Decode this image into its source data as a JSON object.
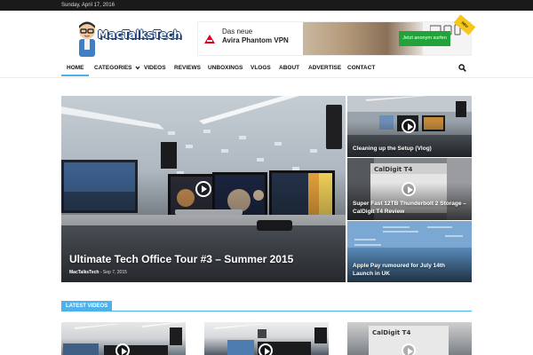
{
  "topbar": {
    "date": "Sunday, April 17, 2016"
  },
  "header": {
    "logo_text": "MacTalksTech",
    "ad": {
      "brand_line1": "Das neue",
      "brand_line2": "Avira Phantom VPN",
      "button_label": "Jetzt anonym surfen",
      "badge": "NEU"
    }
  },
  "nav": {
    "items": [
      {
        "label": "HOME"
      },
      {
        "label": "CATEGORIES"
      },
      {
        "label": "VIDEOS"
      },
      {
        "label": "REVIEWS"
      },
      {
        "label": "UNBOXINGS"
      },
      {
        "label": "VLOGS"
      },
      {
        "label": "ABOUT"
      },
      {
        "label": "ADVERTISE"
      },
      {
        "label": "CONTACT"
      }
    ],
    "dropdown_icon": "chevron-down-icon",
    "search_icon": "search-icon",
    "accent": "#4db2ec"
  },
  "featured": {
    "main": {
      "title": "Ultimate Tech Office Tour #3 – Summer 2015",
      "author": "MacTalksTech",
      "date": "Sep 7, 2015"
    },
    "side": [
      {
        "title": "Cleaning up the Setup (Vlog)"
      },
      {
        "title": "Super Fast 12TB Thunderbolt 2 Storage – CalDigit T4 Review"
      },
      {
        "title": "Apple Pay rumoured for July 14th Launch in UK"
      }
    ]
  },
  "latest": {
    "heading": "LATEST VIDEOS"
  }
}
